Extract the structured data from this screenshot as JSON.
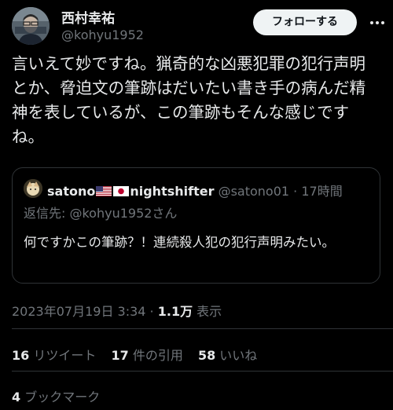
{
  "author": {
    "name": "西村幸祐",
    "handle": "@kohyu1952",
    "follow_label": "フォローする"
  },
  "tweet": {
    "text": "言いえて妙ですね。猟奇的な凶悪犯罪の犯行声明とか、脅迫文の筆跡はだいたい書き手の病んだ精神を表しているが、この筆跡もそんな感じですね。"
  },
  "quote": {
    "name_part1": "satono",
    "name_part2": "nightshifter",
    "handle": "@satono01",
    "separator": " · ",
    "time": "17時間",
    "reply_to": "返信先: @kohyu1952さん",
    "text": "何ですかこの筆跡？！連続殺人犯の犯行声明みたい。"
  },
  "meta": {
    "datetime": "2023年07月19日 3:34",
    "dot": " · ",
    "views": "1.1万",
    "views_label": " 表示"
  },
  "stats": {
    "retweets": "16",
    "retweets_label": "リツイート",
    "quotes": "17",
    "quotes_label": "件の引用",
    "likes": "58",
    "likes_label": "いいね",
    "bookmarks": "4",
    "bookmarks_label": "ブックマーク"
  },
  "colors": {
    "background": "#000000",
    "text": "#e7e9ea",
    "secondary": "#71767b",
    "border": "#2f3336",
    "button_bg": "#eff3f4"
  },
  "icons": [
    "avatar-image",
    "more-icon",
    "us-flag-icon",
    "japan-flag-icon"
  ]
}
